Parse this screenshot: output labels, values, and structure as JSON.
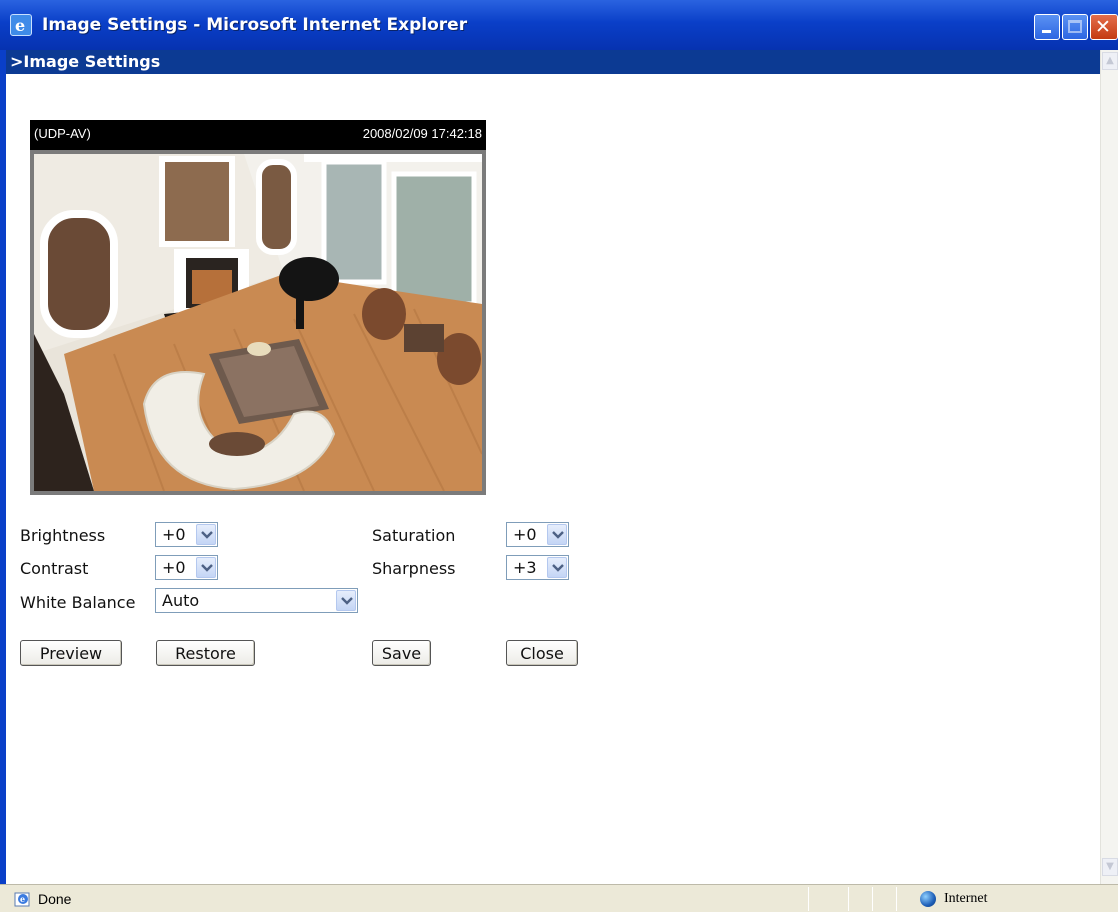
{
  "window": {
    "title": "Image Settings - Microsoft Internet Explorer"
  },
  "page": {
    "heading": ">Image Settings"
  },
  "viewer": {
    "mode": "(UDP-AV)",
    "timestamp": "2008/02/09 17:42:18"
  },
  "settings": {
    "brightness": {
      "label": "Brightness",
      "value": "+0"
    },
    "contrast": {
      "label": "Contrast",
      "value": "+0"
    },
    "white_balance": {
      "label": "White Balance",
      "value": "Auto"
    },
    "saturation": {
      "label": "Saturation",
      "value": "+0"
    },
    "sharpness": {
      "label": "Sharpness",
      "value": "+3"
    }
  },
  "buttons": {
    "preview": "Preview",
    "restore": "Restore",
    "save": "Save",
    "close": "Close"
  },
  "statusbar": {
    "status": "Done",
    "zone": "Internet"
  },
  "colors": {
    "titlebar": "#0a3fc8",
    "page_header": "#0c3a93"
  }
}
